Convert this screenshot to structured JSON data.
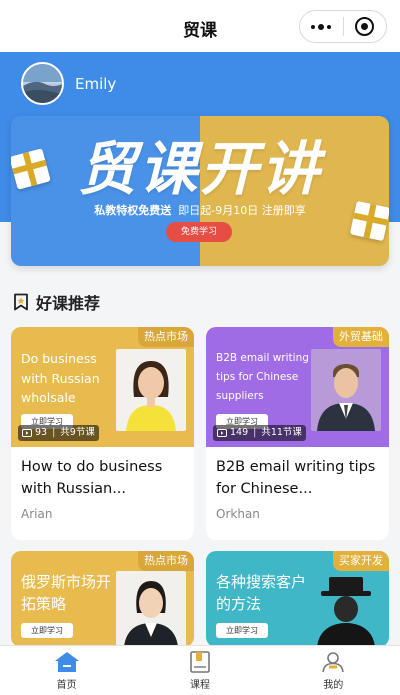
{
  "nav": {
    "title": "贸课"
  },
  "user": {
    "name": "Emily"
  },
  "banner": {
    "headline": "贸课开讲",
    "promo": "私教特权免费送",
    "dates": "即日起-9月10日 注册即享",
    "button": "免费学习"
  },
  "section": {
    "title": "好课推荐"
  },
  "courses": [
    {
      "tag": "热点市场",
      "thumb_text": "Do business with Russian wholsale",
      "button": "立即学习",
      "views": "93",
      "lessons": "共9节课",
      "title": "How to do business with Russian...",
      "author": "Arian",
      "color": "#e7bb4e"
    },
    {
      "tag": "外贸基础",
      "thumb_text": "B2B email writing tips for Chinese suppliers",
      "button": "立即学习",
      "views": "149",
      "lessons": "共11节课",
      "title": "B2B email writing tips for Chinese...",
      "author": "Orkhan",
      "color": "#a06ce6"
    },
    {
      "tag": "热点市场",
      "thumb_text": "俄罗斯市场开拓策略",
      "button": "立即学习",
      "color": "#e7bb4e"
    },
    {
      "tag": "买家开发",
      "thumb_text": "各种搜索客户的方法",
      "button": "立即学习",
      "color": "#3fb7c7"
    }
  ],
  "tabbar": [
    {
      "label": "首页",
      "icon": "home-icon",
      "color": "#3f8be8"
    },
    {
      "label": "课程",
      "icon": "book-icon",
      "color": "#888888"
    },
    {
      "label": "我的",
      "icon": "user-icon",
      "color": "#888888"
    }
  ],
  "colors": {
    "primary": "#3f8be8",
    "gold": "#e0b64f",
    "accent_red": "#e64d45"
  }
}
